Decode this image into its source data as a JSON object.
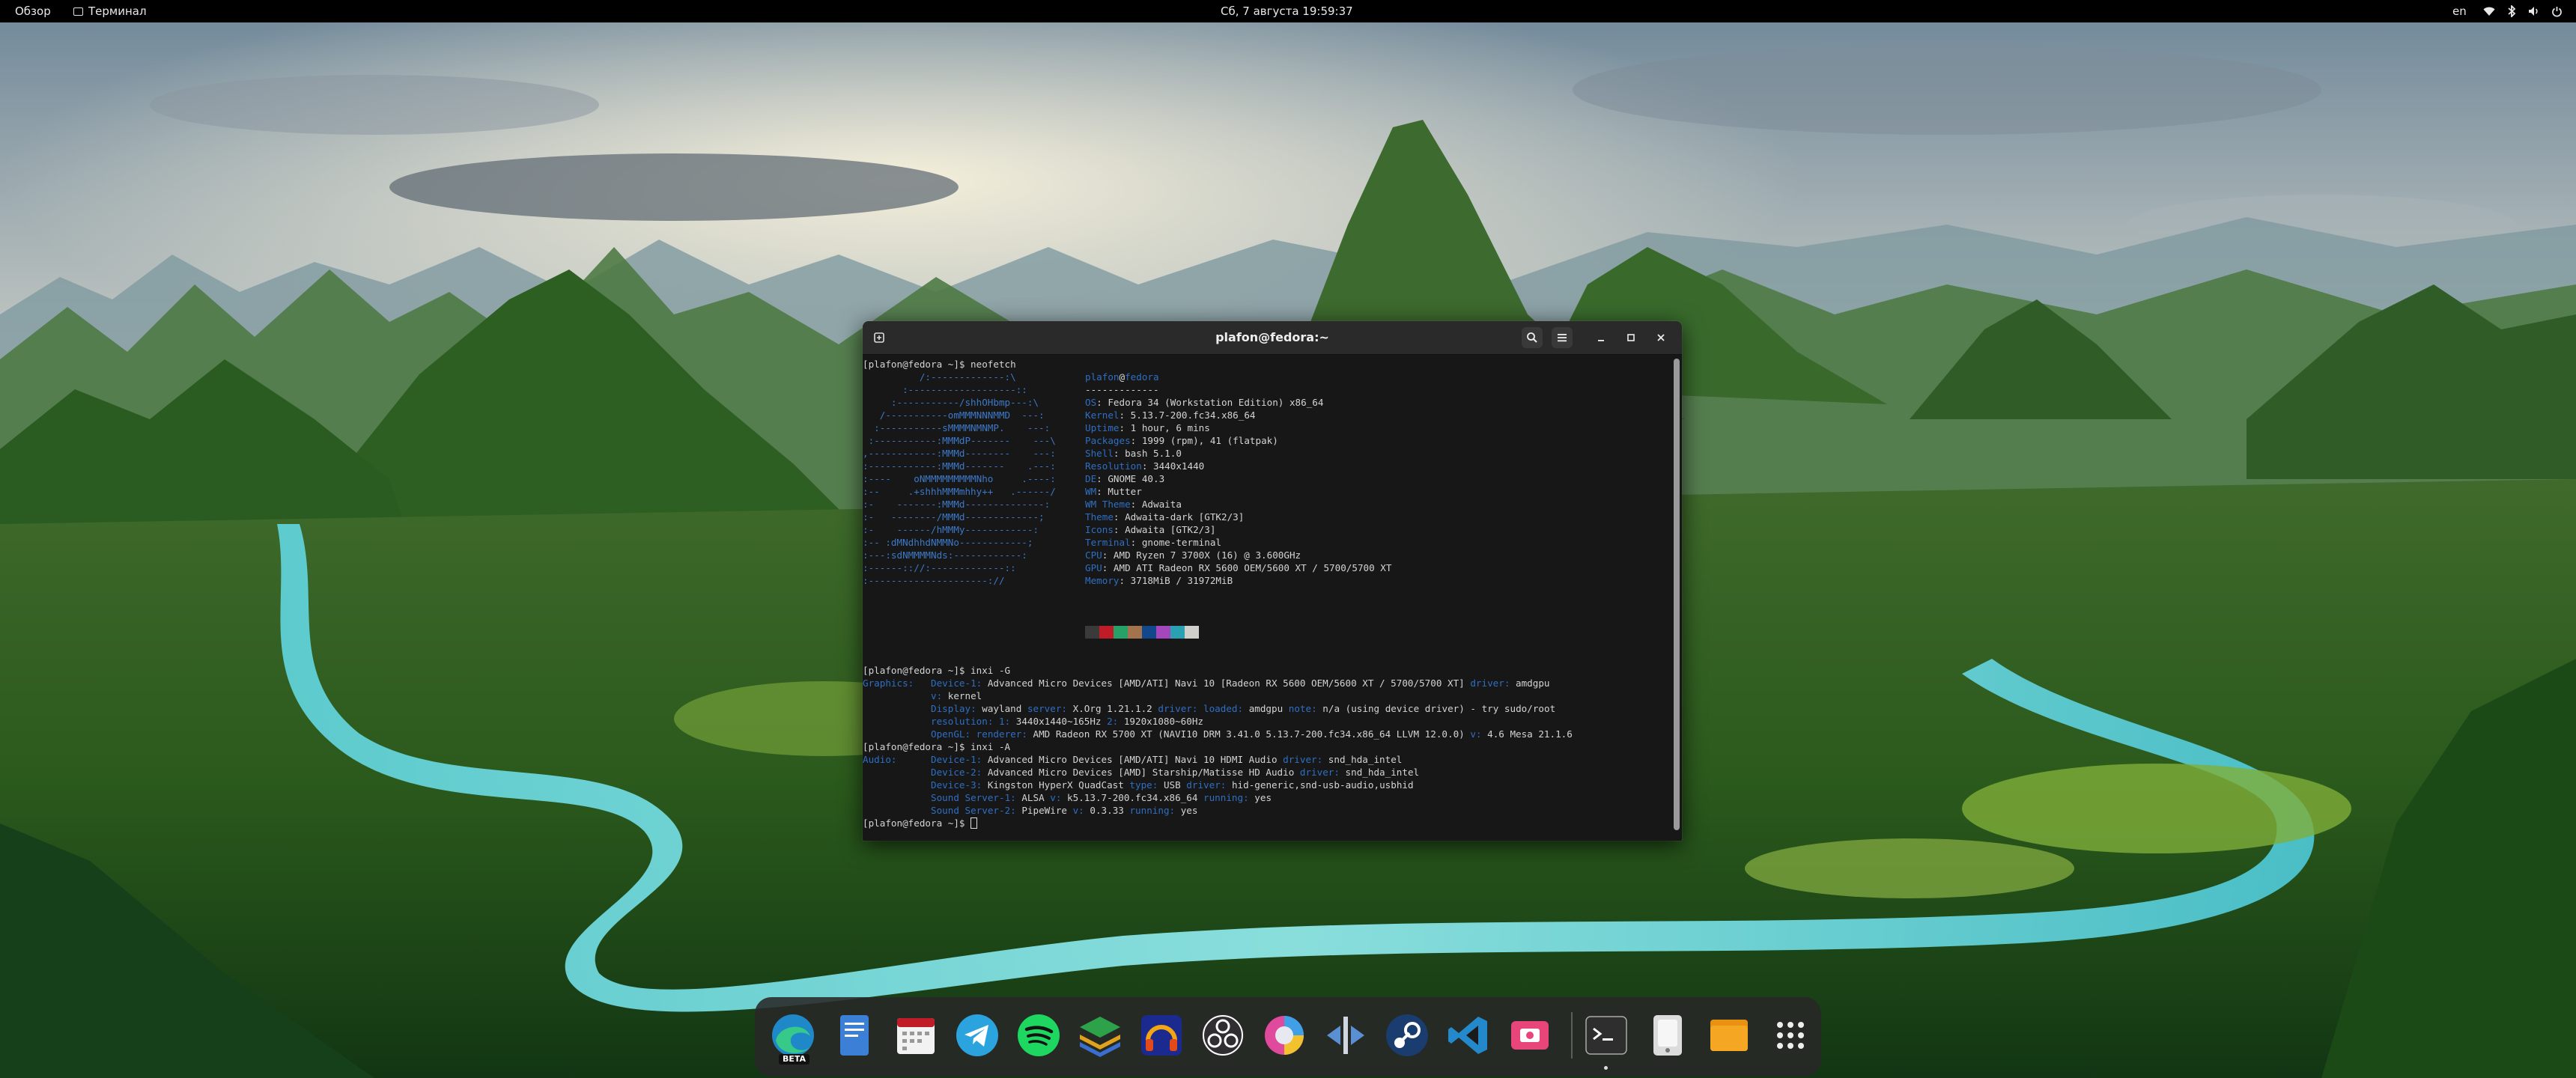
{
  "topbar": {
    "overview": "Обзор",
    "app_name": "Терминал",
    "clock": "Сб, 7 августа  19:59:37",
    "lang": "en",
    "tray_icons": [
      "wifi-icon",
      "bluetooth-icon",
      "volume-icon",
      "battery-icon",
      "power-icon"
    ]
  },
  "terminal": {
    "title": "plafon@fedora:~",
    "header_buttons": [
      "new-tab-icon",
      "search-icon",
      "menu-icon",
      "minimize-icon",
      "maximize-icon",
      "close-icon"
    ],
    "colors": {
      "background": "#171717",
      "ascii_logo": "#3d78c7",
      "key": "#2f6fc3",
      "text": "#d4d4d4"
    },
    "prompt_neofetch": "[plafon@fedora ~]$ neofetch",
    "ascii_logo": [
      "          /:-------------:\\",
      "       :-------------------::",
      "     :-----------/shhOHbmp---:\\",
      "   /-----------omMMMNNNMMD  ---:",
      "  :-----------sMMMMNMNMP.    ---:",
      " :-----------:MMMdP-------    ---\\",
      ",------------:MMMd--------    ---:",
      ":------------:MMMd-------    .---:",
      ":----    oNMMMMMMMMMNho     .----:",
      ":--     .+shhhMMMmhhy++   .------/",
      ":-    -------:MMMd--------------:",
      ":-   --------/MMMd-------------;",
      ":-    ------/hMMMy------------:",
      ":-- :dMNdhhdNMMNo------------;",
      ":---:sdNMMMMNds:------------:",
      ":------:://:-------------::",
      ":---------------------://"
    ],
    "sysinfo": {
      "user": "plafon",
      "at": "@",
      "host": "fedora",
      "separator": "-------------",
      "lines": [
        {
          "key": "OS",
          "value": "Fedora 34 (Workstation Edition) x86_64"
        },
        {
          "key": "Kernel",
          "value": "5.13.7-200.fc34.x86_64"
        },
        {
          "key": "Uptime",
          "value": "1 hour, 6 mins"
        },
        {
          "key": "Packages",
          "value": "1999 (rpm), 41 (flatpak)"
        },
        {
          "key": "Shell",
          "value": "bash 5.1.0"
        },
        {
          "key": "Resolution",
          "value": "3440x1440"
        },
        {
          "key": "DE",
          "value": "GNOME 40.3"
        },
        {
          "key": "WM",
          "value": "Mutter"
        },
        {
          "key": "WM Theme",
          "value": "Adwaita"
        },
        {
          "key": "Theme",
          "value": "Adwaita-dark [GTK2/3]"
        },
        {
          "key": "Icons",
          "value": "Adwaita [GTK2/3]"
        },
        {
          "key": "Terminal",
          "value": "gnome-terminal"
        },
        {
          "key": "CPU",
          "value": "AMD Ryzen 7 3700X (16) @ 3.600GHz"
        },
        {
          "key": "GPU",
          "value": "AMD ATI Radeon RX 5600 OEM/5600 XT / 5700/5700 XT"
        },
        {
          "key": "Memory",
          "value": "3718MiB / 31972MiB"
        }
      ],
      "swatches": [
        "#3a3a3a",
        "#c01c28",
        "#26a269",
        "#a2734c",
        "#12488b",
        "#a347ba",
        "#2aa1b3",
        "#d0cfcc",
        "#5e5c64",
        "#f66151",
        "#33d17a",
        "#e9ad0c",
        "#2a7bde",
        "#c061cb",
        "#33c7de",
        "#ffffff"
      ]
    },
    "prompt_inxi_g": "[plafon@fedora ~]$ inxi -G",
    "inxi_g": [
      {
        "key": "Graphics:",
        "indent": 0,
        "parts": [
          {
            "k": "Device-1:",
            "v": "Advanced Micro Devices [AMD/ATI] Navi 10 [Radeon RX 5600 OEM/5600 XT / 5700/5700 XT]"
          },
          {
            "k": "driver:",
            "v": "amdgpu"
          }
        ]
      },
      {
        "key": "",
        "indent": 1,
        "parts": [
          {
            "k": "v:",
            "v": "kernel"
          }
        ]
      },
      {
        "key": "",
        "indent": 1,
        "parts": [
          {
            "k": "Display:",
            "v": "wayland"
          },
          {
            "k": "server:",
            "v": "X.Org 1.21.1.2"
          },
          {
            "k": "driver: loaded:",
            "v": "amdgpu"
          },
          {
            "k": "note:",
            "v": "n/a (using device driver) - try sudo/root"
          }
        ]
      },
      {
        "key": "",
        "indent": 1,
        "parts": [
          {
            "k": "resolution: 1:",
            "v": "3440x1440~165Hz"
          },
          {
            "k": "2:",
            "v": "1920x1080~60Hz"
          }
        ]
      },
      {
        "key": "",
        "indent": 1,
        "parts": [
          {
            "k": "OpenGL: renderer:",
            "v": "AMD Radeon RX 5700 XT (NAVI10 DRM 3.41.0 5.13.7-200.fc34.x86_64 LLVM 12.0.0)"
          },
          {
            "k": "v:",
            "v": "4.6 Mesa 21.1.6"
          }
        ]
      }
    ],
    "prompt_inxi_a": "[plafon@fedora ~]$ inxi -A",
    "inxi_a": [
      {
        "key": "Audio:",
        "indent": 0,
        "parts": [
          {
            "k": "Device-1:",
            "v": "Advanced Micro Devices [AMD/ATI] Navi 10 HDMI Audio"
          },
          {
            "k": "driver:",
            "v": "snd_hda_intel"
          }
        ]
      },
      {
        "key": "",
        "indent": 1,
        "parts": [
          {
            "k": "Device-2:",
            "v": "Advanced Micro Devices [AMD] Starship/Matisse HD Audio"
          },
          {
            "k": "driver:",
            "v": "snd_hda_intel"
          }
        ]
      },
      {
        "key": "",
        "indent": 1,
        "parts": [
          {
            "k": "Device-3:",
            "v": "Kingston HyperX QuadCast"
          },
          {
            "k": "type:",
            "v": "USB"
          },
          {
            "k": "driver:",
            "v": "hid-generic,snd-usb-audio,usbhid"
          }
        ]
      },
      {
        "key": "",
        "indent": 1,
        "parts": [
          {
            "k": "Sound Server-1:",
            "v": "ALSA"
          },
          {
            "k": "v:",
            "v": "k5.13.7-200.fc34.x86_64"
          },
          {
            "k": "running:",
            "v": "yes"
          }
        ]
      },
      {
        "key": "",
        "indent": 1,
        "parts": [
          {
            "k": "Sound Server-2:",
            "v": "PipeWire"
          },
          {
            "k": "v:",
            "v": "0.3.33"
          },
          {
            "k": "running:",
            "v": "yes"
          }
        ]
      }
    ],
    "prompt_final": "[plafon@fedora ~]$ "
  },
  "dock": {
    "items": [
      {
        "name": "microsoft-edge-beta-icon",
        "badge": "BETA"
      },
      {
        "name": "text-editor-icon"
      },
      {
        "name": "calendar-icon"
      },
      {
        "name": "telegram-icon"
      },
      {
        "name": "spotify-icon"
      },
      {
        "name": "layers-icon"
      },
      {
        "name": "headphones-app-icon"
      },
      {
        "name": "obs-studio-icon"
      },
      {
        "name": "color-picker-icon"
      },
      {
        "name": "network-tool-icon"
      },
      {
        "name": "steam-icon"
      },
      {
        "name": "vscode-icon"
      },
      {
        "name": "screen-recorder-icon"
      },
      {
        "name": "terminal-icon",
        "running": true
      },
      {
        "name": "disk-utility-icon"
      },
      {
        "name": "files-icon"
      },
      {
        "name": "app-grid-icon"
      }
    ]
  }
}
